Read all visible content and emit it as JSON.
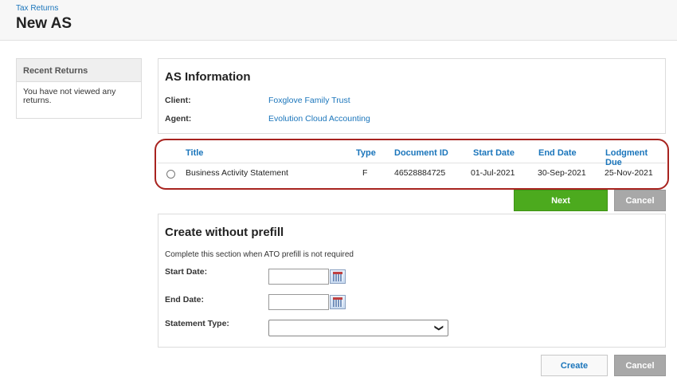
{
  "header": {
    "breadcrumb": "Tax Returns",
    "title": "New AS"
  },
  "sidebar": {
    "heading": "Recent Returns",
    "empty_text": "You have not viewed any returns."
  },
  "as_info": {
    "title": "AS Information",
    "client_label": "Client:",
    "client_value": "Foxglove Family Trust",
    "agent_label": "Agent:",
    "agent_value": "Evolution Cloud Accounting"
  },
  "table": {
    "columns": [
      "Title",
      "Type",
      "Document ID",
      "Start Date",
      "End Date",
      "Lodgment Due"
    ],
    "rows": [
      {
        "title": "Business Activity Statement",
        "type": "F",
        "document_id": "46528884725",
        "start_date": "01-Jul-2021",
        "end_date": "30-Sep-2021",
        "lodgment_due": "25-Nov-2021"
      }
    ]
  },
  "actions_top": {
    "next": "Next",
    "cancel": "Cancel"
  },
  "prefill": {
    "title": "Create without prefill",
    "note": "Complete this section when ATO prefill is not required",
    "start_label": "Start Date:",
    "end_label": "End Date:",
    "type_label": "Statement Type:",
    "start_value": "",
    "end_value": "",
    "type_value": ""
  },
  "actions_bottom": {
    "create": "Create",
    "cancel": "Cancel"
  },
  "colors": {
    "link": "#1a75bb",
    "next": "#4caa1e",
    "cancel": "#a8a8a8",
    "highlight": "#a8231f"
  }
}
